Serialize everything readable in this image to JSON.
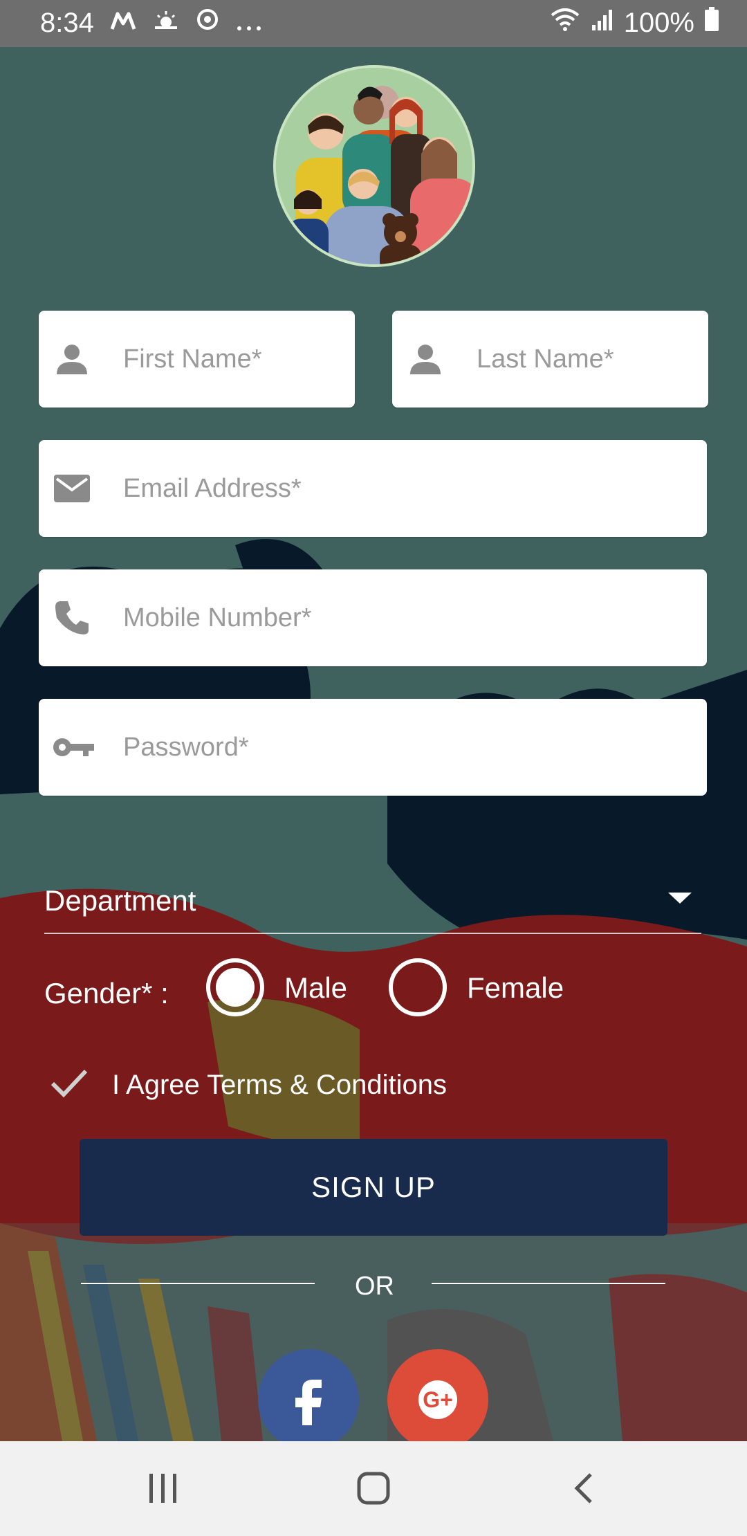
{
  "status_bar": {
    "time": "8:34",
    "battery": "100%",
    "icons": [
      "motorola-m-icon",
      "weather-icon",
      "sync-icon",
      "more-icon",
      "wifi-icon",
      "signal-icon",
      "battery-icon"
    ]
  },
  "form": {
    "first_name_placeholder": "First Name*",
    "last_name_placeholder": "Last Name*",
    "email_placeholder": "Email Address*",
    "mobile_placeholder": "Mobile Number*",
    "password_placeholder": "Password*",
    "department_label": "Department",
    "gender_label": "Gender* :",
    "gender_options": [
      "Male",
      "Female"
    ],
    "gender_selected": "Male",
    "agree_text": "I Agree Terms & Conditions",
    "signup_label": "SIGN UP",
    "or_label": "OR"
  },
  "colors": {
    "background": "#3f625f",
    "signup_button": "#182b4d",
    "facebook": "#3b5998",
    "google": "#dd4b39"
  }
}
